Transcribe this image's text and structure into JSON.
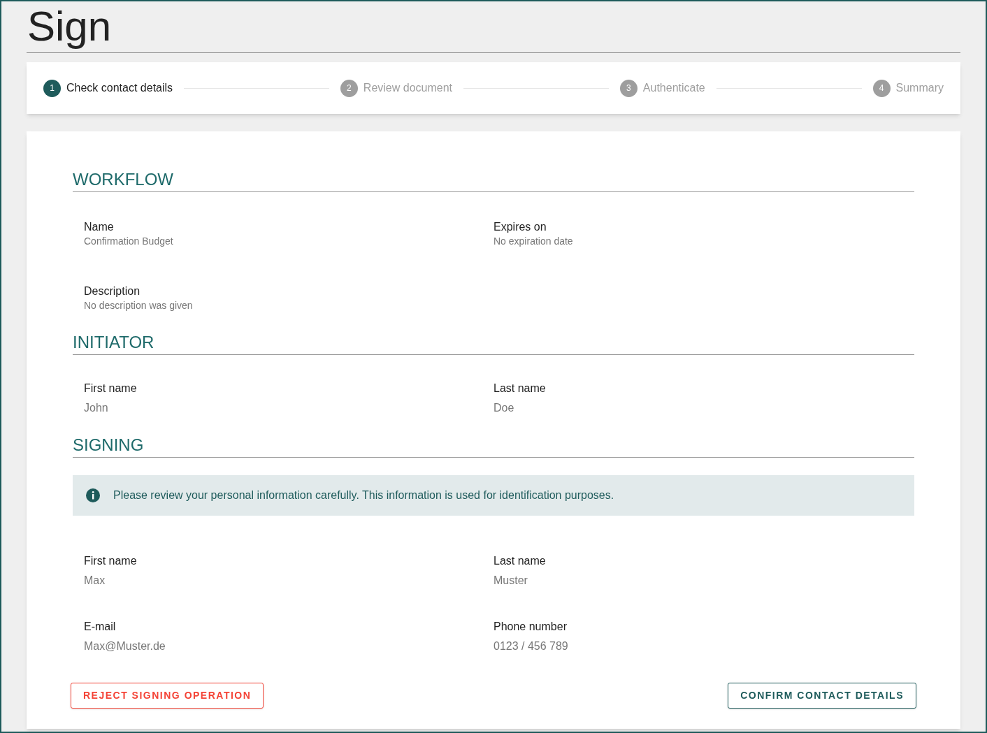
{
  "title": "Sign",
  "steps": [
    {
      "number": "1",
      "label": "Check contact details",
      "selected": true
    },
    {
      "number": "2",
      "label": "Review document",
      "selected": false
    },
    {
      "number": "3",
      "label": "Authenticate",
      "selected": false
    },
    {
      "number": "4",
      "label": "Summary",
      "selected": false
    }
  ],
  "sections": [
    {
      "heading": "WORKFLOW",
      "kind": "details",
      "fields": [
        {
          "label": "Name",
          "value": "Confirmation Budget"
        },
        {
          "label": "Expires on",
          "value": "No expiration date"
        },
        {
          "label": "Description",
          "value": "No description was given"
        }
      ]
    },
    {
      "heading": "INITIATOR",
      "kind": "contact",
      "fields": [
        {
          "label": "First name",
          "value": "John"
        },
        {
          "label": "Last name",
          "value": "Doe"
        }
      ]
    },
    {
      "heading": "SIGNING",
      "kind": "contact",
      "notice": "Please review your personal information carefully. This information is used for identification purposes.",
      "fields": [
        {
          "label": "First name",
          "value": "Max"
        },
        {
          "label": "Last name",
          "value": "Muster"
        },
        {
          "label": "E-mail",
          "value": "Max@Muster.de"
        },
        {
          "label": "Phone number",
          "value": "0123 / 456 789"
        }
      ]
    }
  ],
  "buttons": [
    {
      "label": "REJECT SIGNING OPERATION",
      "kind": "reject"
    },
    {
      "label": "CONFIRM CONTACT DETAILS",
      "kind": "confirm"
    }
  ]
}
